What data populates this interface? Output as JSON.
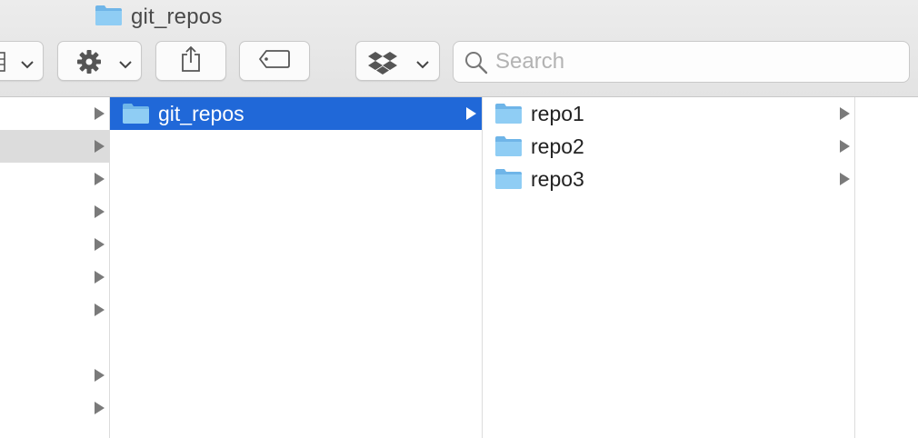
{
  "window": {
    "title": "git_repos"
  },
  "toolbar": {
    "view_button_icon": "column-view-icon",
    "action_button_icon": "gear-icon",
    "share_button_icon": "share-icon",
    "tag_button_icon": "tag-icon",
    "dropbox_button_icon": "dropbox-icon",
    "search": {
      "placeholder": "Search",
      "value": ""
    }
  },
  "columns": {
    "parent": {
      "row_count_with_arrows": 8,
      "highlighted_row": 2
    },
    "current": {
      "items": [
        {
          "label": "git_repos",
          "selected": true,
          "has_children": true
        }
      ]
    },
    "children": {
      "items": [
        {
          "label": "repo1",
          "has_children": true
        },
        {
          "label": "repo2",
          "has_children": true
        },
        {
          "label": "repo3",
          "has_children": true
        }
      ]
    }
  },
  "colors": {
    "selection": "#2068d8",
    "folder": "#75bfef",
    "toolbar_bg": "#e8e8e8"
  }
}
